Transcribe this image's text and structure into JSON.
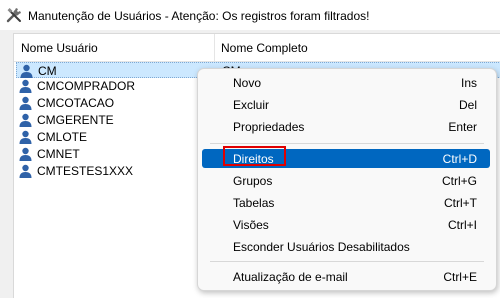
{
  "window": {
    "title": "Manutenção de Usuários - Atenção: Os registros foram filtrados!",
    "icon": "tools-icon"
  },
  "table": {
    "columns": [
      "Nome Usuário",
      "Nome Completo"
    ],
    "rows": [
      {
        "name": "CM",
        "full": "CM",
        "selected": true
      },
      {
        "name": "CMCOMPRADOR",
        "full": ""
      },
      {
        "name": "CMCOTACAO",
        "full": ""
      },
      {
        "name": "CMGERENTE",
        "full": ""
      },
      {
        "name": "CMLOTE",
        "full": ""
      },
      {
        "name": "CMNET",
        "full": ""
      },
      {
        "name": "CMTESTES1XXX",
        "full": ""
      }
    ],
    "row_icon": "user-icon"
  },
  "context_menu": {
    "items": [
      {
        "label": "Novo",
        "shortcut": "Ins"
      },
      {
        "label": "Excluir",
        "shortcut": "Del"
      },
      {
        "label": "Propriedades",
        "shortcut": "Enter"
      },
      {
        "label": "Direitos",
        "shortcut": "Ctrl+D",
        "highlighted": true
      },
      {
        "label": "Grupos",
        "shortcut": "Ctrl+G"
      },
      {
        "label": "Tabelas",
        "shortcut": "Ctrl+T"
      },
      {
        "label": "Visões",
        "shortcut": "Ctrl+I"
      },
      {
        "label": "Esconder Usuários Desabilitados",
        "shortcut": ""
      },
      {
        "label": "Atualização de e-mail",
        "shortcut": "Ctrl+E"
      }
    ]
  },
  "colors": {
    "menu_highlight": "#0067c0",
    "selection": "#cce8ff",
    "annotation_box": "#e00000",
    "user_icon": "#2f62a8"
  }
}
